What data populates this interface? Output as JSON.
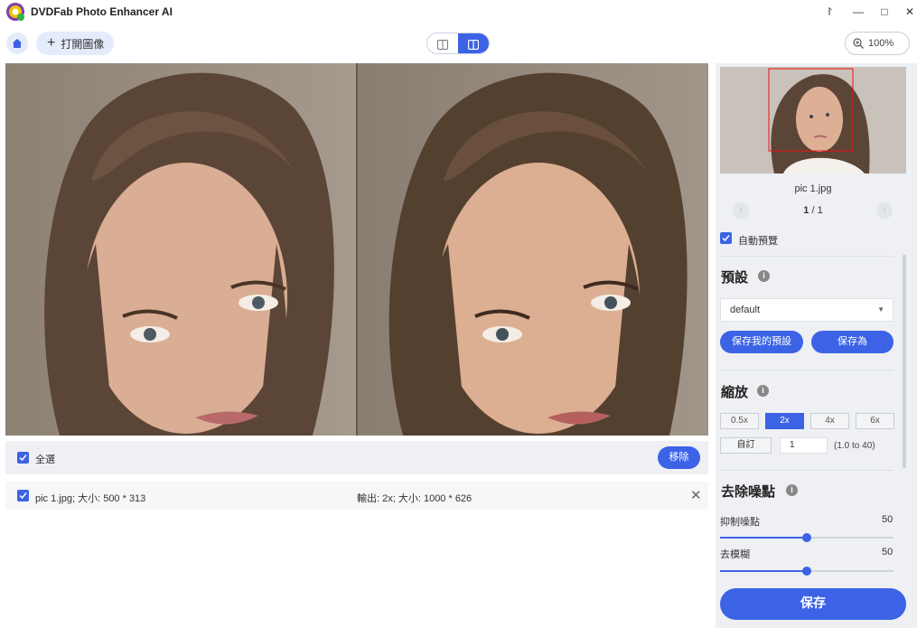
{
  "app": {
    "title": "DVDFab Photo Enhancer AI"
  },
  "window_controls": [
    {
      "name": "menu-icon",
      "glyph": "⨡"
    },
    {
      "name": "minimize-icon",
      "glyph": "—"
    },
    {
      "name": "maximize-icon",
      "glyph": "□"
    },
    {
      "name": "close-icon",
      "glyph": "✕"
    }
  ],
  "toolbar": {
    "open_label": "打開圖像",
    "zoom_level": "100%"
  },
  "list": {
    "select_all_label": "全選",
    "remove_label": "移除",
    "files": [
      {
        "name": "pic 1.jpg; 大小: 500 * 313",
        "output": "輸出: 2x; 大小: 1000 * 626"
      }
    ]
  },
  "sidebar": {
    "thumbnail_name": "pic 1.jpg",
    "pager_current": "1",
    "pager_total": "1",
    "auto_preview_label": "自動預覽",
    "auto_preview_checked": true,
    "preset": {
      "title": "預設",
      "selected": "default",
      "save_mine_label": "保存我的預設",
      "save_as_label": "保存為"
    },
    "scale": {
      "title": "縮放",
      "options": [
        "0.5x",
        "2x",
        "4x",
        "6x"
      ],
      "selected": "2x",
      "custom_label": "自訂",
      "custom_value": "1",
      "custom_range": "(1.0 to 40)"
    },
    "denoise": {
      "title": "去除噪點",
      "noise_label": "抑制噪點",
      "noise_value": 50,
      "noise_display": "50",
      "blur_label": "去模糊",
      "blur_value": 50,
      "blur_display": "50"
    },
    "save_label": "保存"
  },
  "colors": {
    "accent": "#3c63e6",
    "panel": "#eef0f3"
  }
}
